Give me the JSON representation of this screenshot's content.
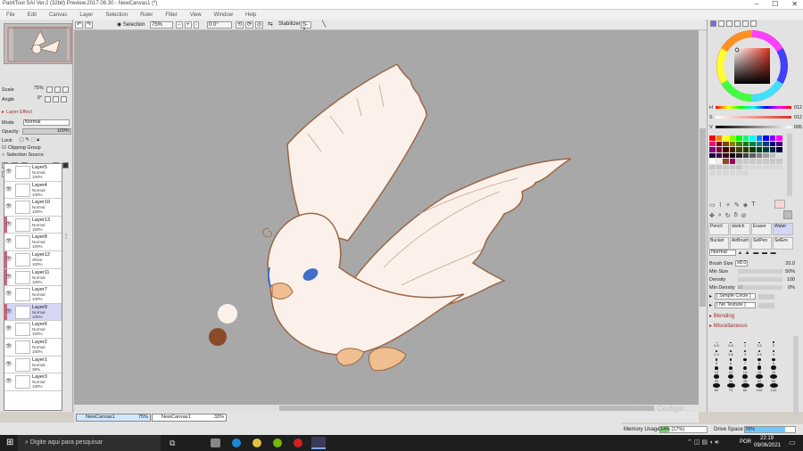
{
  "window": {
    "title": "PaintTool SAI Ver.2 (32bit) Preview.2017.08.30 - NewCanvas1 (*)"
  },
  "menu": [
    "File",
    "Edit",
    "Canvas",
    "Layer",
    "Selection",
    "Ruler",
    "Filter",
    "View",
    "Window",
    "Help"
  ],
  "toolbar": {
    "selection_label": "Selection",
    "zoom": "75%",
    "angle": "0.0°",
    "stabilizer_label": "Stabilizer",
    "stabilizer_value": "S-2"
  },
  "left_panel": {
    "scale_label": "Scale",
    "scale_value": "75%",
    "angle_label": "Angle",
    "angle_value": "0°",
    "layer_effect": "Layer Effect",
    "mode_label": "Mode",
    "mode_value": "Normal",
    "opacity_label": "Opacity",
    "opacity_value": "100%",
    "lock_label": "Lock",
    "clipping_group": "Clipping Group",
    "selection_source": "Selection Source"
  },
  "layers": [
    {
      "name": "Layer5",
      "mode": "Normal",
      "opacity": "100%",
      "clip": false,
      "sel": false
    },
    {
      "name": "Layer4",
      "mode": "Normal",
      "opacity": "100%",
      "clip": false,
      "sel": false
    },
    {
      "name": "Layer10",
      "mode": "Normal",
      "opacity": "100%",
      "clip": false,
      "sel": false
    },
    {
      "name": "Layer13",
      "mode": "Normal",
      "opacity": "100%",
      "clip": true,
      "sel": false
    },
    {
      "name": "Layer8",
      "mode": "Normal",
      "opacity": "100%",
      "clip": false,
      "sel": false
    },
    {
      "name": "Layer12",
      "mode": "Shine",
      "opacity": "100%",
      "clip": true,
      "sel": false
    },
    {
      "name": "Layer11",
      "mode": "Normal",
      "opacity": "100%",
      "clip": true,
      "sel": false
    },
    {
      "name": "Layer7",
      "mode": "Normal",
      "opacity": "100%",
      "clip": false,
      "sel": false
    },
    {
      "name": "Layer9",
      "mode": "Normal",
      "opacity": "100%",
      "clip": true,
      "sel": true
    },
    {
      "name": "Layer6",
      "mode": "Normal",
      "opacity": "100%",
      "clip": false,
      "sel": false
    },
    {
      "name": "Layer2",
      "mode": "Normal",
      "opacity": "100%",
      "clip": false,
      "sel": false
    },
    {
      "name": "Layer1",
      "mode": "Normal",
      "opacity": "38%",
      "clip": false,
      "sel": false
    },
    {
      "name": "Layer3",
      "mode": "Normal",
      "opacity": "100%",
      "clip": false,
      "sel": false
    }
  ],
  "color": {
    "h_label": "H",
    "h": "012",
    "s_label": "S",
    "s": "012",
    "v_label": "V",
    "v": "095",
    "primary": "#f6ece6"
  },
  "tools": {
    "row1": [
      "Pencil",
      "sketch",
      "Eraser",
      "Water"
    ],
    "row2": [
      "Bucket",
      "AirBrush",
      "SelPen",
      "SelErs"
    ],
    "mode": "Normal",
    "brush_size_label": "Brush Size",
    "brush_size_mult": "x8.0",
    "brush_size": "20.0",
    "min_size_label": "Min Size",
    "min_size": "50%",
    "density_label": "Density",
    "density": "100",
    "min_density_label": "Min Density",
    "min_density": "0%",
    "simple_circle": "[ Simple Circle ]",
    "no_texture": "[ No Texture ]",
    "blending": "Blending",
    "misc": "Miscellaneous"
  },
  "brush_sizes": [
    "0.6",
    "0.8",
    "1",
    "1.5",
    "2",
    "2.3",
    "2.6",
    "3",
    "3.5",
    "4",
    "5",
    "6",
    "7",
    "8",
    "9",
    "10",
    "12",
    "14",
    "16",
    "20",
    "25",
    "30",
    "35",
    "40",
    "50",
    "60",
    "70",
    "80",
    "100",
    "120"
  ],
  "docs": [
    {
      "name": "NewCanvas1",
      "zoom": "75%"
    },
    {
      "name": "NewCanvas1",
      "zoom": "33%"
    }
  ],
  "status": {
    "memory_label": "Memory Usage",
    "memory": "14% (17%)",
    "drive_label": "Drive Space",
    "drive": "78%"
  },
  "watermark": "Acesse Configur...",
  "taskbar": {
    "search": "Digite aqui para pesquisar",
    "lang": "POR",
    "time": "22:19",
    "date": "09/06/2021"
  }
}
